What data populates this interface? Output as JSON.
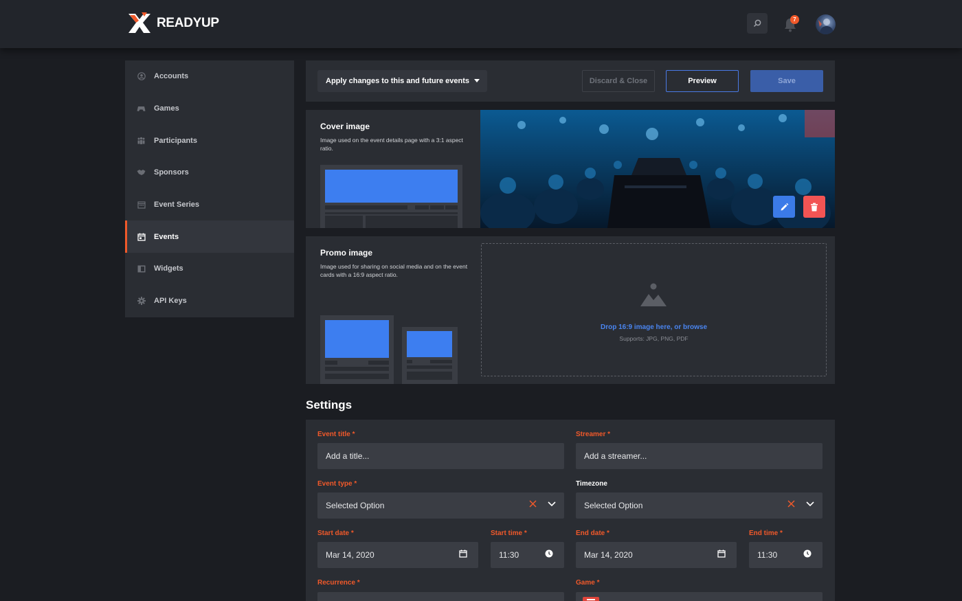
{
  "brand": {
    "name": "READYUP",
    "accent": "#f1592a"
  },
  "topbar": {
    "notification_count": "7"
  },
  "sidebar": {
    "items": [
      {
        "label": "Accounts",
        "icon": "user-circle-icon"
      },
      {
        "label": "Games",
        "icon": "gamepad-icon"
      },
      {
        "label": "Participants",
        "icon": "participants-icon"
      },
      {
        "label": "Sponsors",
        "icon": "handshake-icon"
      },
      {
        "label": "Event Series",
        "icon": "calendar-series-icon"
      },
      {
        "label": "Events",
        "icon": "calendar-icon",
        "active": true
      },
      {
        "label": "Widgets",
        "icon": "widget-icon"
      },
      {
        "label": "API Keys",
        "icon": "gear-icon"
      }
    ]
  },
  "actions": {
    "apply_select": "Apply changes to this and future events",
    "discard": "Discard & Close",
    "preview": "Preview",
    "save": "Save"
  },
  "cover": {
    "title": "Cover image",
    "description": "Image used on the event details page with a 3:1 aspect ratio."
  },
  "promo": {
    "title": "Promo image",
    "description": "Image used for sharing on social media and on the event cards with a 16:9 aspect ratio.",
    "drop_text": "Drop 16:9 image here, or browse",
    "drop_sub": "Supports: JPG, PNG, PDF"
  },
  "settings": {
    "title": "Settings",
    "event_title_label": "Event title *",
    "event_title_placeholder": "Add a title...",
    "streamer_label": "Streamer *",
    "streamer_placeholder": "Add a streamer...",
    "event_type_label": "Event type *",
    "event_type_value": "Selected Option",
    "timezone_label": "Timezone",
    "timezone_value": "Selected Option",
    "start_date_label": "Start date *",
    "start_date_value": "Mar 14, 2020",
    "start_time_label": "Start time *",
    "start_time_value": "11:30",
    "end_date_label": "End date *",
    "end_date_value": "Mar 14, 2020",
    "end_time_label": "End time *",
    "end_time_value": "11:30",
    "recurrence_label": "Recurrence *",
    "game_label": "Game *"
  }
}
